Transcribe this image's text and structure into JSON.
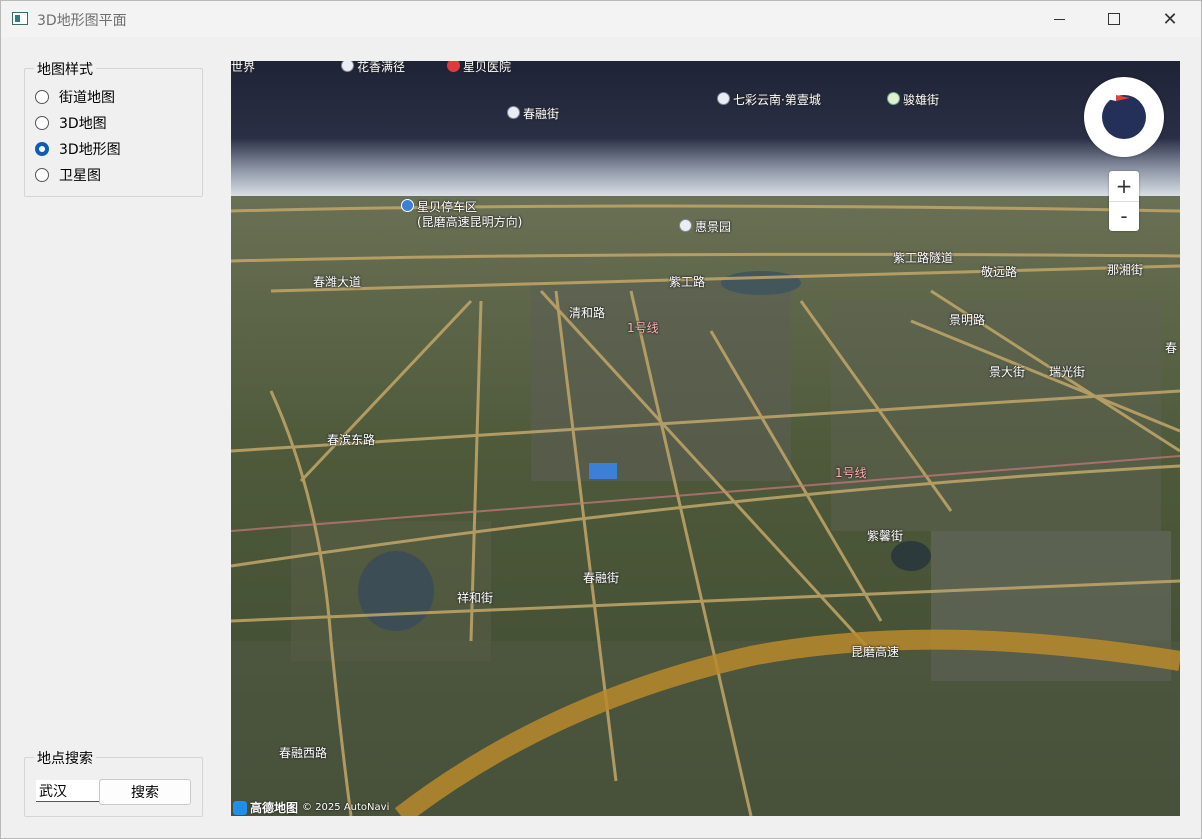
{
  "window": {
    "title": "3D地形图平面"
  },
  "style_group": {
    "title": "地图样式",
    "options": [
      {
        "label": "街道地图",
        "checked": false
      },
      {
        "label": "3D地图",
        "checked": false
      },
      {
        "label": "3D地形图",
        "checked": true
      },
      {
        "label": "卫星图",
        "checked": false
      }
    ]
  },
  "search_group": {
    "title": "地点搜索",
    "input_value": "武汉",
    "button_label": "搜索"
  },
  "map": {
    "labels": {
      "world": "世界",
      "poi1": "花香满径",
      "poi2": "星贝医院",
      "poi3": "春融街",
      "poi4": "七彩云南·第壹城",
      "poi5": "骏雄街",
      "parking": "星贝停车区",
      "parking_sub": "(昆磨高速昆明方向)",
      "poi6": "惠景园",
      "road1": "春潍大道",
      "road2": "紫工路",
      "road3": "紫工路隧道",
      "road4": "敬远路",
      "road5": "那湘街",
      "road6": "清和路",
      "road7": "景明路",
      "road8": "瑞光街",
      "road9": "景大街",
      "road10": "春滨东路",
      "road11": "1号线",
      "road12": "1号线",
      "road13": "紫馨街",
      "road14": "祥和街",
      "road15": "春融街",
      "road16": "昆磨高速",
      "road17": "春融西路",
      "road18": "春"
    },
    "zoom_in": "+",
    "zoom_out": "-",
    "attribution_brand": "高德地图",
    "attribution_text": "© 2025 AutoNavi"
  },
  "colors": {
    "accent": "#0a5fb4",
    "sky_top": "#1f2336",
    "terrain": "#4d5a3d",
    "highway": "#b98a2c"
  }
}
